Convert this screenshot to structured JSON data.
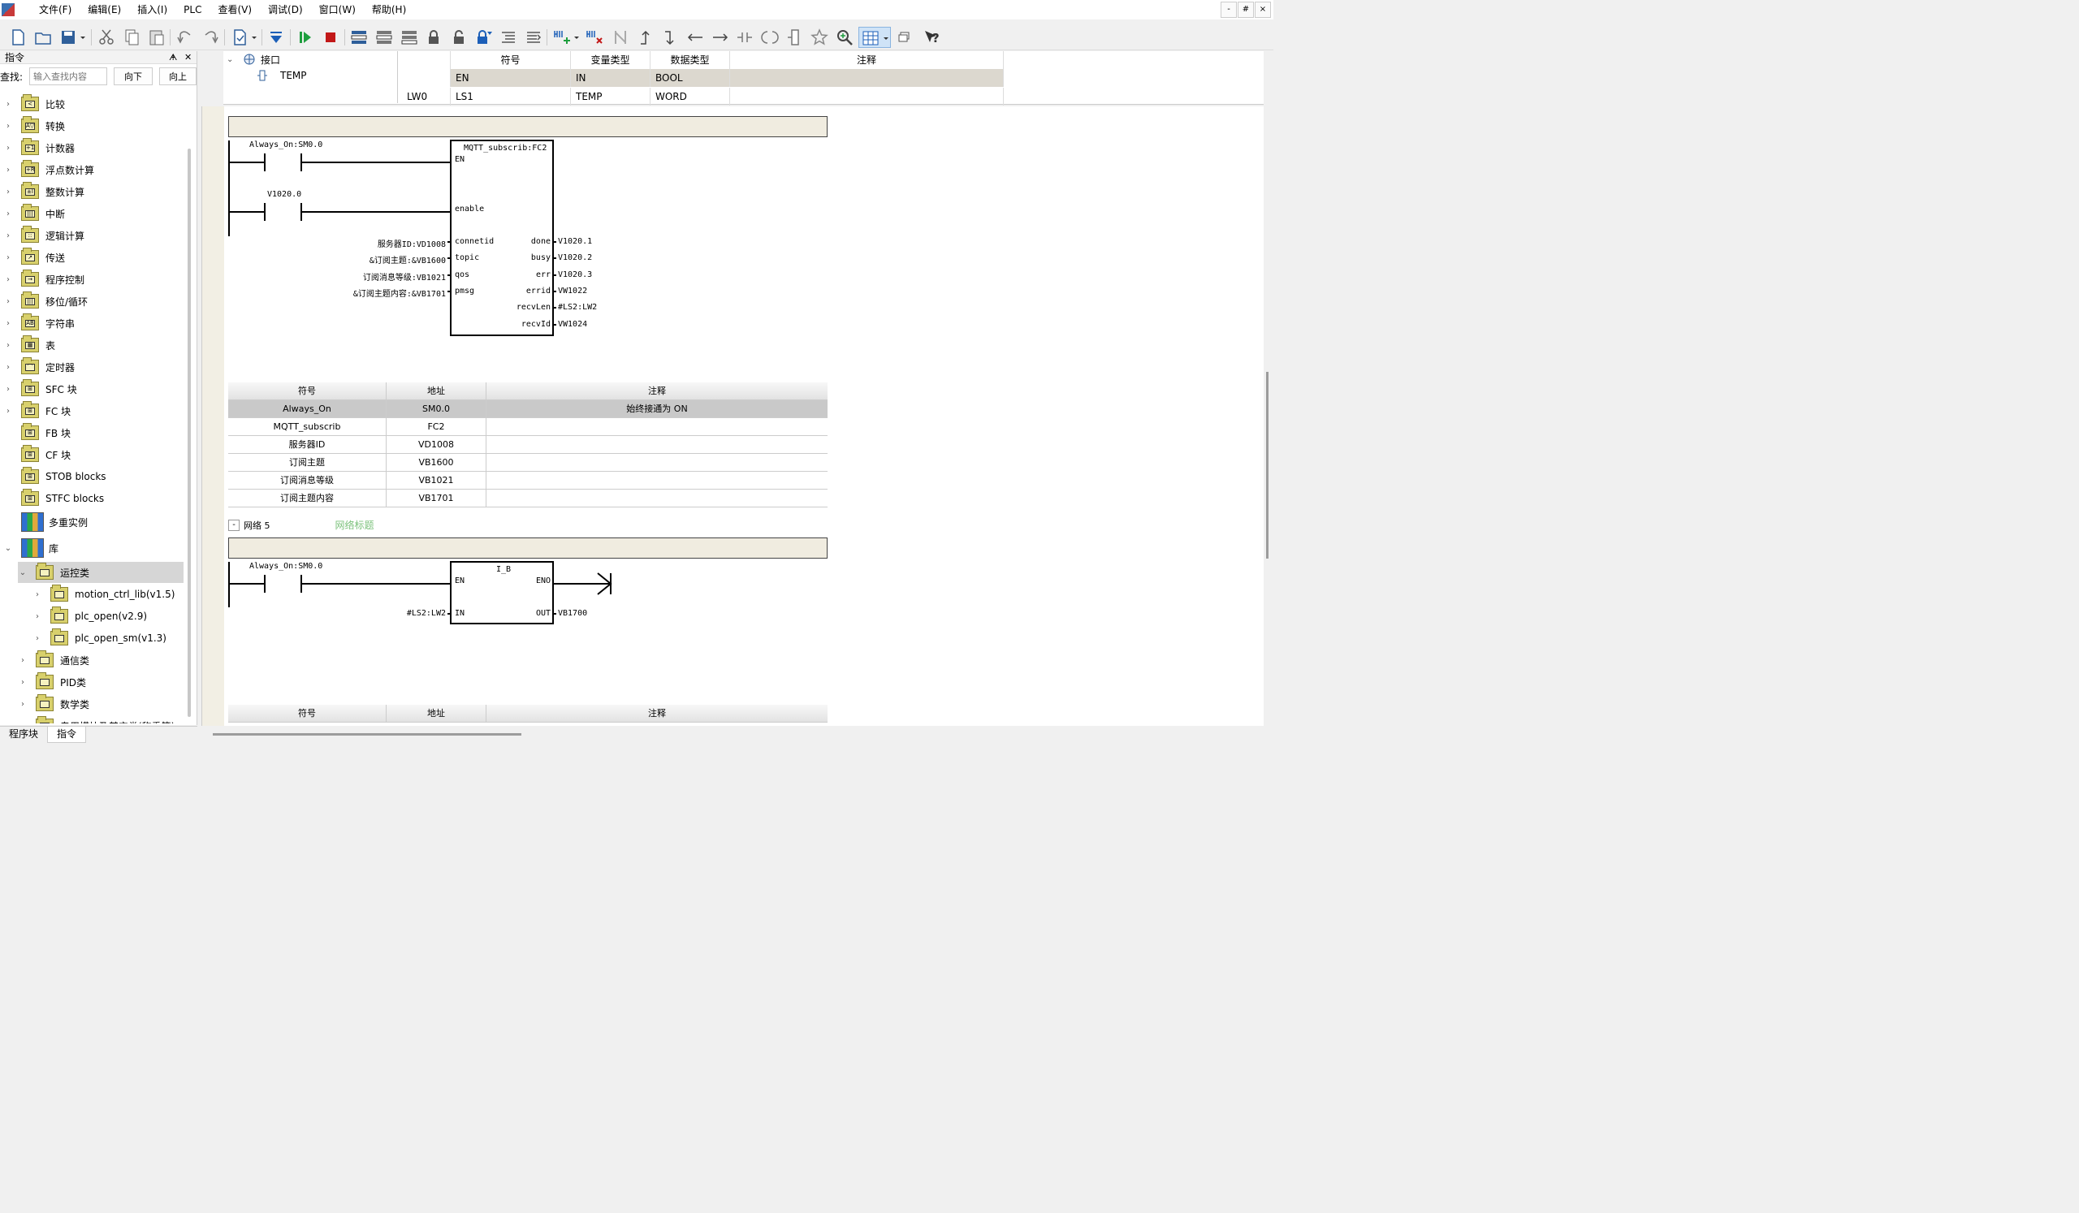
{
  "menu": {
    "items": [
      "文件(F)",
      "编辑(E)",
      "插入(I)",
      "PLC",
      "查看(V)",
      "调试(D)",
      "窗口(W)",
      "帮助(H)"
    ],
    "window_controls": [
      "-",
      "#",
      "×"
    ]
  },
  "left_panel": {
    "title": "指令",
    "pin": "ᗗ",
    "close": "✕",
    "find_label": "查找:",
    "find_placeholder": "输入查找内容",
    "btn_down": "向下",
    "btn_up": "向上",
    "tree": {
      "categories": [
        {
          "label": "比较",
          "glyph": "<"
        },
        {
          "label": "转换",
          "glyph": "A▽"
        },
        {
          "label": "计数器",
          "glyph": "+1"
        },
        {
          "label": "浮点数计算",
          "glyph": "+R"
        },
        {
          "label": "整数计算",
          "glyph": "±I"
        },
        {
          "label": "中断",
          "glyph": "|||"
        },
        {
          "label": "逻辑计算",
          "glyph": "::"
        },
        {
          "label": "传送",
          "glyph": "↗"
        },
        {
          "label": "程序控制",
          "glyph": "→"
        },
        {
          "label": "移位/循环",
          "glyph": "|||"
        },
        {
          "label": "字符串",
          "glyph": "AB"
        },
        {
          "label": "表",
          "glyph": "▦"
        },
        {
          "label": "定时器",
          "glyph": "⌒"
        },
        {
          "label": "SFC 块",
          "glyph": "⊞"
        },
        {
          "label": "FC 块",
          "glyph": "⊞"
        },
        {
          "label": "FB 块",
          "glyph": "⊞"
        },
        {
          "label": "CF 块",
          "glyph": "⊞"
        },
        {
          "label": "STOB blocks",
          "glyph": "⊞"
        },
        {
          "label": "STFC blocks",
          "glyph": "⊞"
        }
      ],
      "multi_instance": "多重实例",
      "library": "库",
      "motion_class": "运控类",
      "motion_children": [
        "motion_ctrl_lib(v1.5)",
        "plc_open(v2.9)",
        "plc_open_sm(v1.3)"
      ],
      "other_classes": [
        "通信类",
        "PID类",
        "数学类",
        "专用模块及其它类(称重等)"
      ]
    },
    "bottom_tabs": [
      "程序块",
      "指令"
    ]
  },
  "interface": {
    "tree_root": "接口",
    "tree_child": "TEMP",
    "headers": [
      "符号",
      "变量类型",
      "数据类型",
      "注释"
    ],
    "rows": [
      {
        "addr": "",
        "symbol": "EN",
        "var_type": "IN",
        "data_type": "BOOL",
        "comment": ""
      },
      {
        "addr": "LW0",
        "symbol": "LS1",
        "var_type": "TEMP",
        "data_type": "WORD",
        "comment": ""
      }
    ]
  },
  "network4": {
    "contact1": "Always_On:SM0.0",
    "contact2": "V1020.0",
    "block_title": "MQTT_subscrib:FC2",
    "block_pins_left": [
      "EN",
      "enable",
      "connetid",
      "topic",
      "qos",
      "pmsg"
    ],
    "block_inputs": [
      "服务器ID:VD1008",
      "&订阅主题:&VB1600",
      "订阅消息等级:VB1021",
      "&订阅主题内容:&VB1701"
    ],
    "block_pins_right": [
      "done",
      "busy",
      "err",
      "errid",
      "recvLen",
      "recvId"
    ],
    "block_outputs": [
      "V1020.1",
      "V1020.2",
      "V1020.3",
      "VW1022",
      "#LS2:LW2",
      "VW1024"
    ],
    "symbol_table": {
      "headers": [
        "符号",
        "地址",
        "注释"
      ],
      "rows": [
        [
          "Always_On",
          "SM0.0",
          "始终接通为 ON"
        ],
        [
          "MQTT_subscrib",
          "FC2",
          ""
        ],
        [
          "服务器ID",
          "VD1008",
          ""
        ],
        [
          "订阅主题",
          "VB1600",
          ""
        ],
        [
          "订阅消息等级",
          "VB1021",
          ""
        ],
        [
          "订阅主题内容",
          "VB1701",
          ""
        ]
      ]
    }
  },
  "network5": {
    "toggle": "-",
    "label": "网络 5",
    "title": "网络标题",
    "contact": "Always_On:SM0.0",
    "block_title": "I_B",
    "pin_en": "EN",
    "pin_eno": "ENO",
    "pin_in": "IN",
    "pin_out": "OUT",
    "input": "#LS2:LW2",
    "output": "VB1700",
    "symbol_table": {
      "headers": [
        "符号",
        "地址",
        "注释"
      ]
    }
  }
}
